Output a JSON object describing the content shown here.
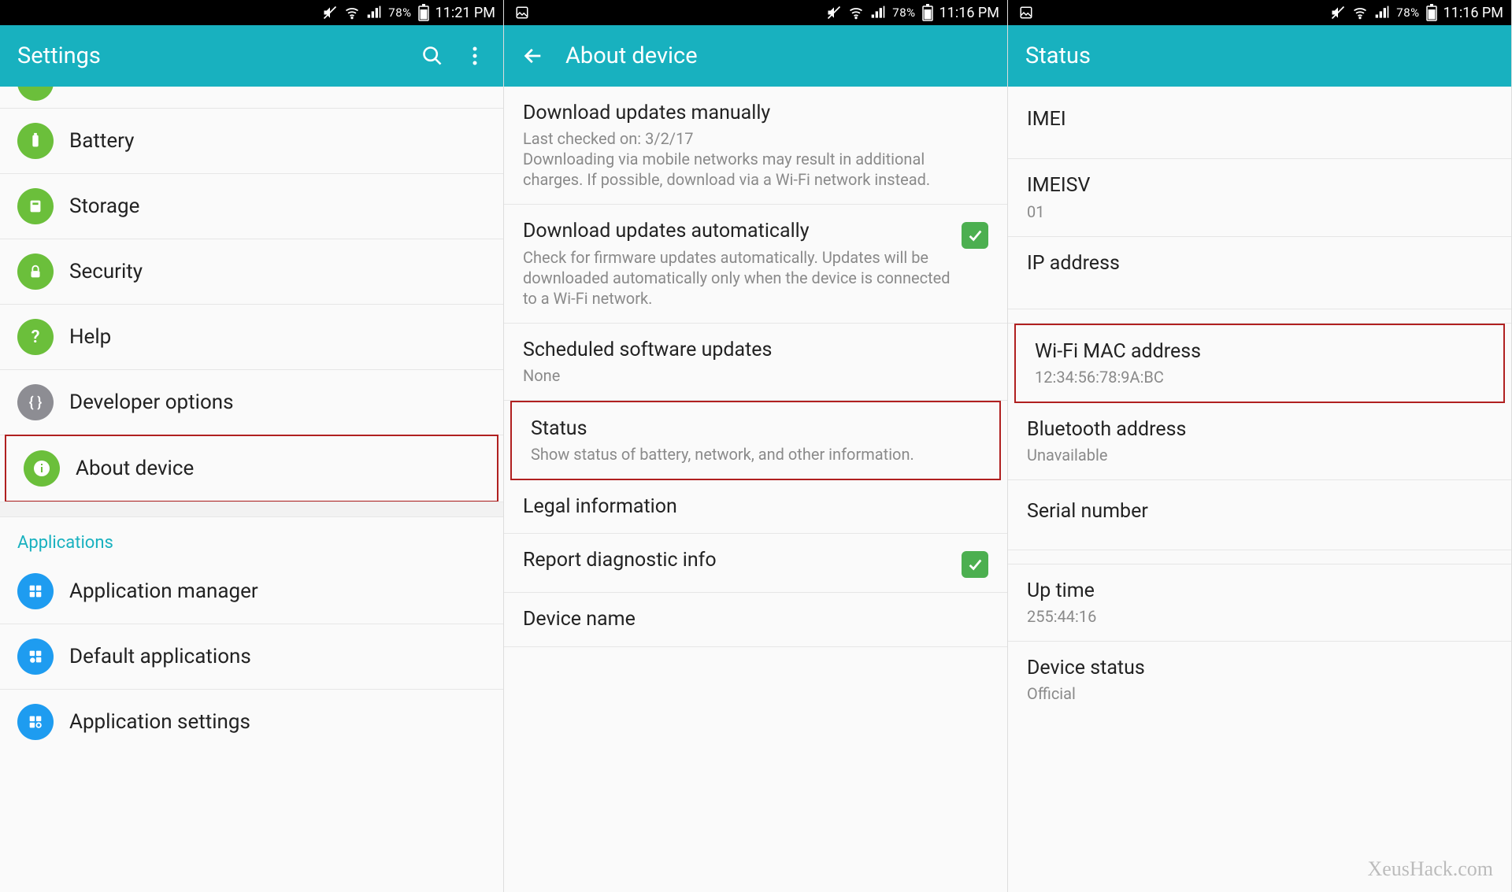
{
  "statusbar": {
    "battery_pct": "78%",
    "time1": "11:21 PM",
    "time2": "11:16 PM"
  },
  "phone1": {
    "title": "Settings",
    "items": [
      {
        "label": "Battery"
      },
      {
        "label": "Storage"
      },
      {
        "label": "Security"
      },
      {
        "label": "Help"
      },
      {
        "label": "Developer options"
      },
      {
        "label": "About device"
      }
    ],
    "section_apps": "Applications",
    "apps": [
      {
        "label": "Application manager"
      },
      {
        "label": "Default applications"
      },
      {
        "label": "Application settings"
      }
    ]
  },
  "phone2": {
    "title": "About device",
    "items": [
      {
        "title": "Download updates manually",
        "sub": "Last checked on: 3/2/17\nDownloading via mobile networks may result in additional charges. If possible, download via a Wi-Fi network instead."
      },
      {
        "title": "Download updates automatically",
        "sub": "Check for firmware updates automatically. Updates will be downloaded automatically only when the device is connected to a Wi-Fi network.",
        "checked": true
      },
      {
        "title": "Scheduled software updates",
        "sub": "None"
      },
      {
        "title": "Status",
        "sub": "Show status of battery, network, and other information."
      },
      {
        "title": "Legal information"
      },
      {
        "title": "Report diagnostic info",
        "checked": true
      },
      {
        "title": "Device name"
      }
    ]
  },
  "phone3": {
    "title": "Status",
    "items": [
      {
        "title": "IMEI"
      },
      {
        "title": "IMEISV",
        "sub": "01"
      },
      {
        "title": "IP address"
      },
      {
        "title": "Wi-Fi MAC address",
        "sub": "12:34:56:78:9A:BC"
      },
      {
        "title": "Bluetooth address",
        "sub": "Unavailable"
      },
      {
        "title": "Serial number"
      },
      {
        "title": "Up time",
        "sub": "255:44:16"
      },
      {
        "title": "Device status",
        "sub": "Official"
      }
    ]
  },
  "watermark": "XeusHack.com"
}
